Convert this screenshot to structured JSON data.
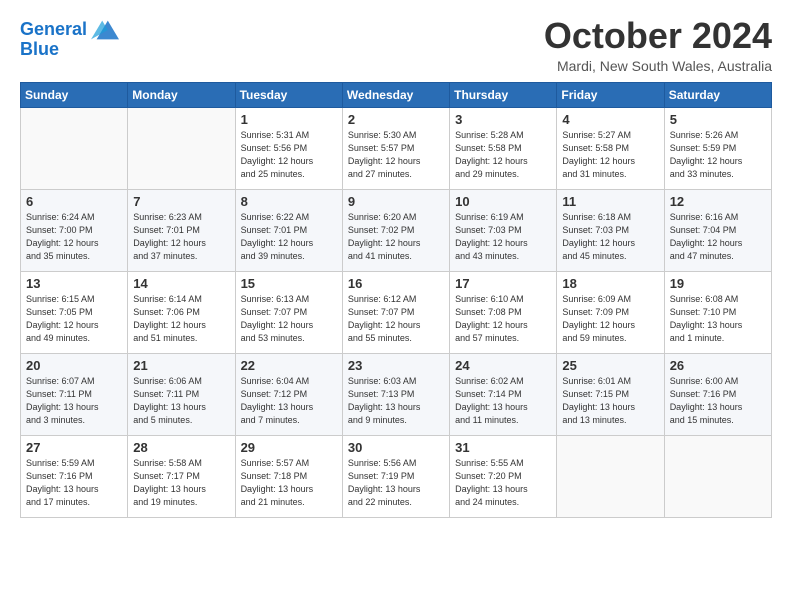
{
  "header": {
    "logo_line1": "General",
    "logo_line2": "Blue",
    "month": "October 2024",
    "location": "Mardi, New South Wales, Australia"
  },
  "weekdays": [
    "Sunday",
    "Monday",
    "Tuesday",
    "Wednesday",
    "Thursday",
    "Friday",
    "Saturday"
  ],
  "weeks": [
    [
      {
        "day": "",
        "detail": ""
      },
      {
        "day": "",
        "detail": ""
      },
      {
        "day": "1",
        "detail": "Sunrise: 5:31 AM\nSunset: 5:56 PM\nDaylight: 12 hours\nand 25 minutes."
      },
      {
        "day": "2",
        "detail": "Sunrise: 5:30 AM\nSunset: 5:57 PM\nDaylight: 12 hours\nand 27 minutes."
      },
      {
        "day": "3",
        "detail": "Sunrise: 5:28 AM\nSunset: 5:58 PM\nDaylight: 12 hours\nand 29 minutes."
      },
      {
        "day": "4",
        "detail": "Sunrise: 5:27 AM\nSunset: 5:58 PM\nDaylight: 12 hours\nand 31 minutes."
      },
      {
        "day": "5",
        "detail": "Sunrise: 5:26 AM\nSunset: 5:59 PM\nDaylight: 12 hours\nand 33 minutes."
      }
    ],
    [
      {
        "day": "6",
        "detail": "Sunrise: 6:24 AM\nSunset: 7:00 PM\nDaylight: 12 hours\nand 35 minutes."
      },
      {
        "day": "7",
        "detail": "Sunrise: 6:23 AM\nSunset: 7:01 PM\nDaylight: 12 hours\nand 37 minutes."
      },
      {
        "day": "8",
        "detail": "Sunrise: 6:22 AM\nSunset: 7:01 PM\nDaylight: 12 hours\nand 39 minutes."
      },
      {
        "day": "9",
        "detail": "Sunrise: 6:20 AM\nSunset: 7:02 PM\nDaylight: 12 hours\nand 41 minutes."
      },
      {
        "day": "10",
        "detail": "Sunrise: 6:19 AM\nSunset: 7:03 PM\nDaylight: 12 hours\nand 43 minutes."
      },
      {
        "day": "11",
        "detail": "Sunrise: 6:18 AM\nSunset: 7:03 PM\nDaylight: 12 hours\nand 45 minutes."
      },
      {
        "day": "12",
        "detail": "Sunrise: 6:16 AM\nSunset: 7:04 PM\nDaylight: 12 hours\nand 47 minutes."
      }
    ],
    [
      {
        "day": "13",
        "detail": "Sunrise: 6:15 AM\nSunset: 7:05 PM\nDaylight: 12 hours\nand 49 minutes."
      },
      {
        "day": "14",
        "detail": "Sunrise: 6:14 AM\nSunset: 7:06 PM\nDaylight: 12 hours\nand 51 minutes."
      },
      {
        "day": "15",
        "detail": "Sunrise: 6:13 AM\nSunset: 7:07 PM\nDaylight: 12 hours\nand 53 minutes."
      },
      {
        "day": "16",
        "detail": "Sunrise: 6:12 AM\nSunset: 7:07 PM\nDaylight: 12 hours\nand 55 minutes."
      },
      {
        "day": "17",
        "detail": "Sunrise: 6:10 AM\nSunset: 7:08 PM\nDaylight: 12 hours\nand 57 minutes."
      },
      {
        "day": "18",
        "detail": "Sunrise: 6:09 AM\nSunset: 7:09 PM\nDaylight: 12 hours\nand 59 minutes."
      },
      {
        "day": "19",
        "detail": "Sunrise: 6:08 AM\nSunset: 7:10 PM\nDaylight: 13 hours\nand 1 minute."
      }
    ],
    [
      {
        "day": "20",
        "detail": "Sunrise: 6:07 AM\nSunset: 7:11 PM\nDaylight: 13 hours\nand 3 minutes."
      },
      {
        "day": "21",
        "detail": "Sunrise: 6:06 AM\nSunset: 7:11 PM\nDaylight: 13 hours\nand 5 minutes."
      },
      {
        "day": "22",
        "detail": "Sunrise: 6:04 AM\nSunset: 7:12 PM\nDaylight: 13 hours\nand 7 minutes."
      },
      {
        "day": "23",
        "detail": "Sunrise: 6:03 AM\nSunset: 7:13 PM\nDaylight: 13 hours\nand 9 minutes."
      },
      {
        "day": "24",
        "detail": "Sunrise: 6:02 AM\nSunset: 7:14 PM\nDaylight: 13 hours\nand 11 minutes."
      },
      {
        "day": "25",
        "detail": "Sunrise: 6:01 AM\nSunset: 7:15 PM\nDaylight: 13 hours\nand 13 minutes."
      },
      {
        "day": "26",
        "detail": "Sunrise: 6:00 AM\nSunset: 7:16 PM\nDaylight: 13 hours\nand 15 minutes."
      }
    ],
    [
      {
        "day": "27",
        "detail": "Sunrise: 5:59 AM\nSunset: 7:16 PM\nDaylight: 13 hours\nand 17 minutes."
      },
      {
        "day": "28",
        "detail": "Sunrise: 5:58 AM\nSunset: 7:17 PM\nDaylight: 13 hours\nand 19 minutes."
      },
      {
        "day": "29",
        "detail": "Sunrise: 5:57 AM\nSunset: 7:18 PM\nDaylight: 13 hours\nand 21 minutes."
      },
      {
        "day": "30",
        "detail": "Sunrise: 5:56 AM\nSunset: 7:19 PM\nDaylight: 13 hours\nand 22 minutes."
      },
      {
        "day": "31",
        "detail": "Sunrise: 5:55 AM\nSunset: 7:20 PM\nDaylight: 13 hours\nand 24 minutes."
      },
      {
        "day": "",
        "detail": ""
      },
      {
        "day": "",
        "detail": ""
      }
    ]
  ]
}
